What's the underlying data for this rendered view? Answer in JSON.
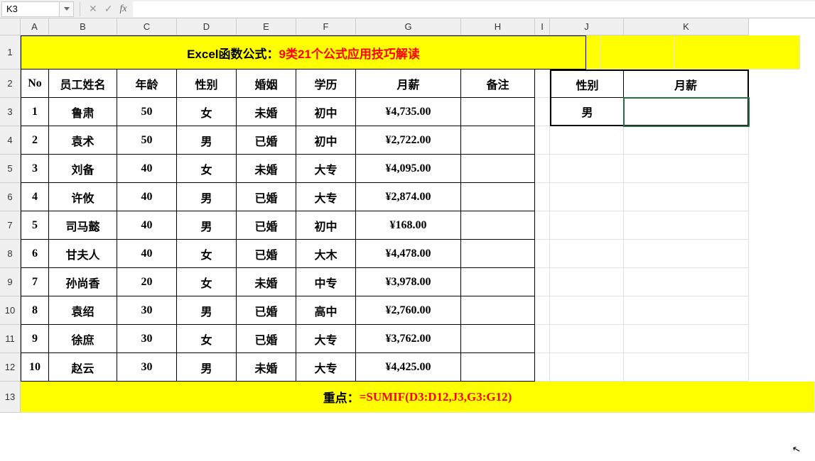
{
  "nameBox": "K3",
  "formulaInput": "",
  "columns": [
    "A",
    "B",
    "C",
    "D",
    "E",
    "F",
    "G",
    "H",
    "I",
    "J",
    "K"
  ],
  "rowNumbers": [
    1,
    2,
    3,
    4,
    5,
    6,
    7,
    8,
    9,
    10,
    11,
    12,
    13
  ],
  "title": {
    "prefix": "Excel函数公式：",
    "highlight": "9类21个公式应用技巧解读"
  },
  "headers": [
    "No",
    "员工姓名",
    "年龄",
    "性别",
    "婚姻",
    "学历",
    "月薪",
    "备注"
  ],
  "sideHeaders": [
    "性别",
    "月薪"
  ],
  "sideRow": [
    "男",
    ""
  ],
  "data": [
    [
      "1",
      "鲁肃",
      "50",
      "女",
      "未婚",
      "初中",
      "¥4,735.00",
      ""
    ],
    [
      "2",
      "袁术",
      "50",
      "男",
      "已婚",
      "初中",
      "¥2,722.00",
      ""
    ],
    [
      "3",
      "刘备",
      "40",
      "女",
      "未婚",
      "大专",
      "¥4,095.00",
      ""
    ],
    [
      "4",
      "许攸",
      "40",
      "男",
      "已婚",
      "大专",
      "¥2,874.00",
      ""
    ],
    [
      "5",
      "司马懿",
      "40",
      "男",
      "已婚",
      "初中",
      "¥168.00",
      ""
    ],
    [
      "6",
      "甘夫人",
      "40",
      "女",
      "已婚",
      "大木",
      "¥4,478.00",
      ""
    ],
    [
      "7",
      "孙尚香",
      "20",
      "女",
      "未婚",
      "中专",
      "¥3,978.00",
      ""
    ],
    [
      "8",
      "袁绍",
      "30",
      "男",
      "已婚",
      "高中",
      "¥2,760.00",
      ""
    ],
    [
      "9",
      "徐庶",
      "30",
      "女",
      "已婚",
      "大专",
      "¥3,762.00",
      ""
    ],
    [
      "10",
      "赵云",
      "30",
      "男",
      "未婚",
      "大专",
      "¥4,425.00",
      ""
    ]
  ],
  "note": {
    "prefix": "重点：",
    "formula": "=SUMIF(D3:D12,J3,G3:G12)"
  },
  "selectedCell": "K3"
}
